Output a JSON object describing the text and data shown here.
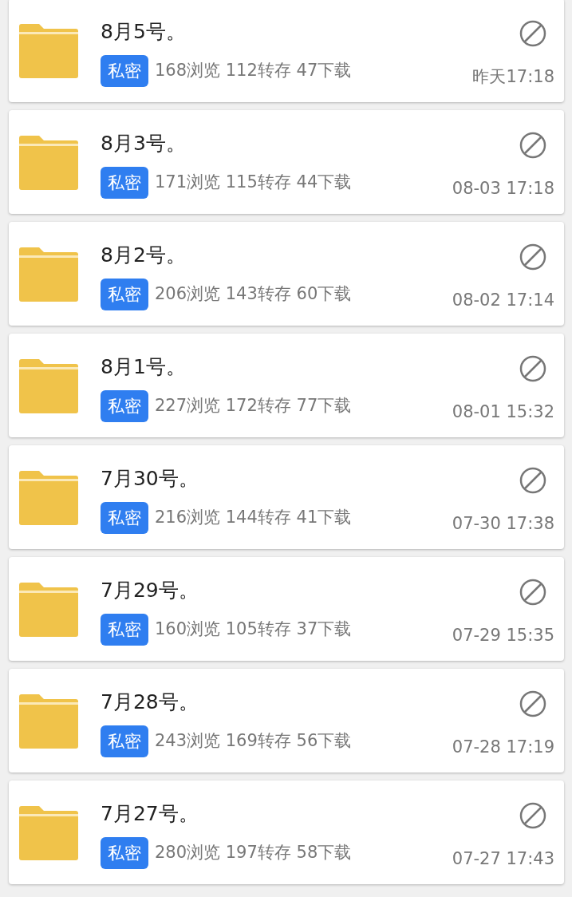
{
  "folders": [
    {
      "title": "8月5号。",
      "tag": "私密",
      "stats": "168浏览 112转存 47下载",
      "time": "昨天17:18"
    },
    {
      "title": "8月3号。",
      "tag": "私密",
      "stats": "171浏览 115转存 44下载",
      "time": "08-03 17:18"
    },
    {
      "title": "8月2号。",
      "tag": "私密",
      "stats": "206浏览 143转存 60下载",
      "time": "08-02 17:14"
    },
    {
      "title": "8月1号。",
      "tag": "私密",
      "stats": "227浏览 172转存 77下载",
      "time": "08-01 15:32"
    },
    {
      "title": "7月30号。",
      "tag": "私密",
      "stats": "216浏览 144转存 41下载",
      "time": "07-30 17:38"
    },
    {
      "title": "7月29号。",
      "tag": "私密",
      "stats": "160浏览 105转存 37下载",
      "time": "07-29 15:35"
    },
    {
      "title": "7月28号。",
      "tag": "私密",
      "stats": "243浏览 169转存 56下载",
      "time": "07-28 17:19"
    },
    {
      "title": "7月27号。",
      "tag": "私密",
      "stats": "280浏览 197转存 58下载",
      "time": "07-27 17:43"
    }
  ]
}
